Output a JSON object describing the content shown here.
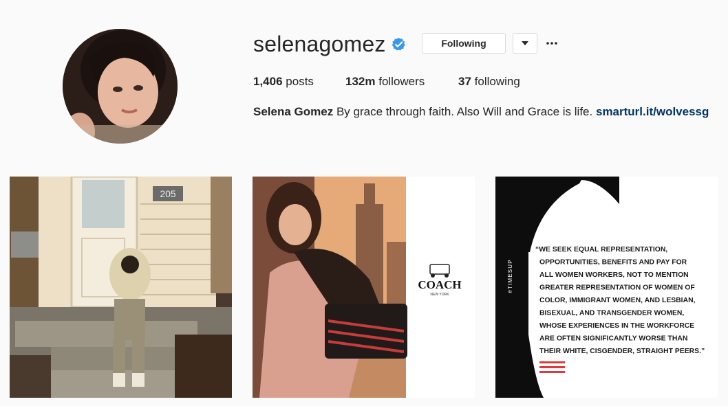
{
  "profile": {
    "username": "selenagomez",
    "following_button": "Following",
    "stats": {
      "posts_count": "1,406",
      "posts_label": "posts",
      "followers_count": "132m",
      "followers_label": "followers",
      "following_count": "37",
      "following_label": "following"
    },
    "bio": {
      "name": "Selena Gomez",
      "text": "By grace through faith. Also Will and Grace is life.",
      "link": "smarturl.it/wolvessg"
    }
  },
  "posts": [
    {
      "house_number": "205"
    },
    {
      "brand": "COACH",
      "brand_sub": "NEW YORK"
    },
    {
      "side_tag": "#TIMESUP",
      "quote_lines": [
        "“WE SEEK EQUAL REPRESENTATION,",
        "OPPORTUNITIES, BENEFITS AND PAY FOR",
        "ALL WOMEN WORKERS, NOT TO MENTION",
        "GREATER REPRESENTATION OF WOMEN OF",
        "COLOR, IMMIGRANT WOMEN, AND LESBIAN,",
        "BISEXUAL, AND TRANSGENDER WOMEN,",
        "WHOSE EXPERIENCES IN THE WORKFORCE",
        "ARE OFTEN SIGNIFICANTLY WORSE THAN",
        "THEIR WHITE, CISGENDER, STRAIGHT PEERS.”"
      ]
    }
  ],
  "colors": {
    "verified_blue": "#3897f0",
    "link": "#003569",
    "timesup_red": "#e0383f"
  },
  "icons": {
    "verified": "verified-badge-icon",
    "dropdown": "caret-down-icon",
    "more": "more-options-icon"
  }
}
